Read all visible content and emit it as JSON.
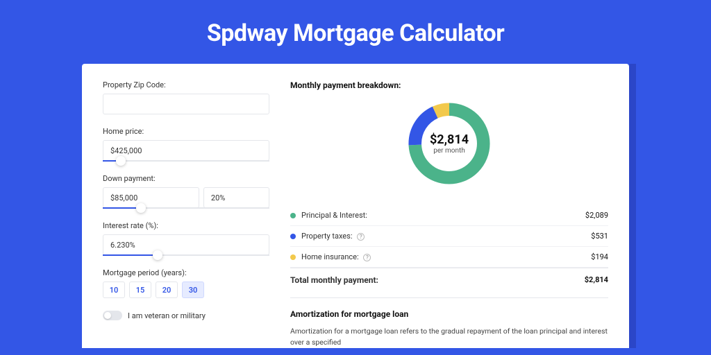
{
  "title": "Spdway Mortgage Calculator",
  "form": {
    "zip_label": "Property Zip Code:",
    "zip_value": "",
    "price_label": "Home price:",
    "price_value": "$425,000",
    "price_slider_pct": 8,
    "down_label": "Down payment:",
    "down_value": "$85,000",
    "down_pct_value": "20%",
    "down_slider_pct": 20,
    "rate_label": "Interest rate (%):",
    "rate_value": "6.230%",
    "rate_slider_pct": 30,
    "period_label": "Mortgage period (years):",
    "periods": [
      "10",
      "15",
      "20",
      "30"
    ],
    "period_active_index": 3,
    "veteran_label": "I am veteran or military"
  },
  "breakdown": {
    "title": "Monthly payment breakdown:",
    "center_value": "$2,814",
    "center_sub": "per month",
    "rows": [
      {
        "color": "#4bb38a",
        "label": "Principal & Interest:",
        "info": false,
        "value": "$2,089"
      },
      {
        "color": "#3356e6",
        "label": "Property taxes:",
        "info": true,
        "value": "$531"
      },
      {
        "color": "#f2c94c",
        "label": "Home insurance:",
        "info": true,
        "value": "$194"
      }
    ],
    "total_label": "Total monthly payment:",
    "total_value": "$2,814"
  },
  "amort": {
    "title": "Amortization for mortgage loan",
    "text": "Amortization for a mortgage loan refers to the gradual repayment of the loan principal and interest over a specified"
  },
  "chart_data": {
    "type": "pie",
    "title": "Monthly payment breakdown",
    "series": [
      {
        "name": "Principal & Interest",
        "value": 2089,
        "color": "#4bb38a"
      },
      {
        "name": "Property taxes",
        "value": 531,
        "color": "#3356e6"
      },
      {
        "name": "Home insurance",
        "value": 194,
        "color": "#f2c94c"
      }
    ],
    "total": 2814
  }
}
